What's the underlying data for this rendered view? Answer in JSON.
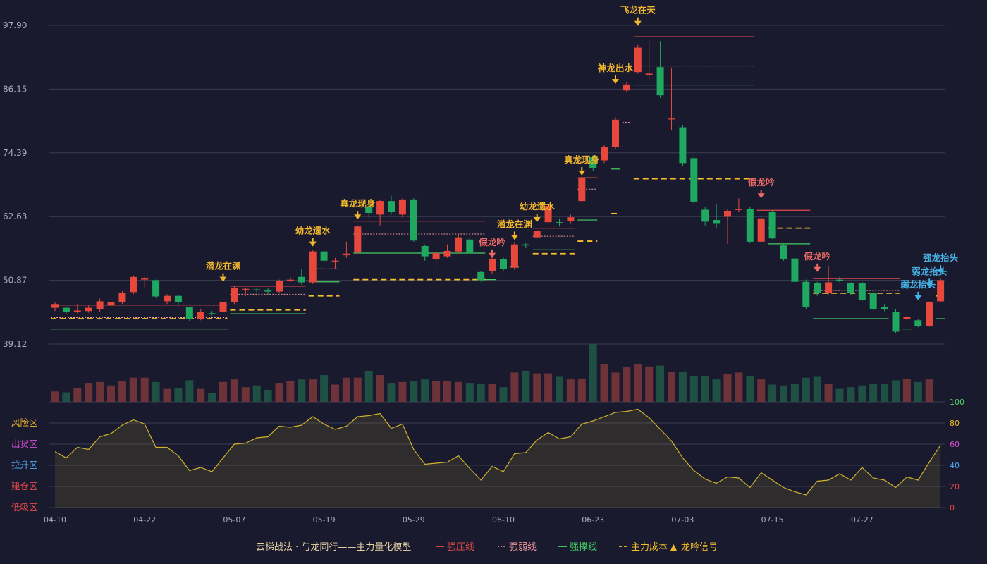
{
  "chart_data": {
    "type": "candlestick",
    "price_axis": {
      "ticks": [
        "97.90",
        "86.15",
        "74.39",
        "62.63",
        "50.87",
        "39.12"
      ],
      "range": [
        39.12,
        97.9
      ]
    },
    "date_ticks": [
      {
        "index": 0,
        "label": "04-10"
      },
      {
        "index": 8,
        "label": "04-22"
      },
      {
        "index": 16,
        "label": "05-07"
      },
      {
        "index": 24,
        "label": "05-19"
      },
      {
        "index": 32,
        "label": "05-29"
      },
      {
        "index": 40,
        "label": "06-10"
      },
      {
        "index": 48,
        "label": "06-23"
      },
      {
        "index": 56,
        "label": "07-03"
      },
      {
        "index": 64,
        "label": "07-15"
      },
      {
        "index": 72,
        "label": "07-27"
      }
    ],
    "candles": [
      [
        45.8,
        46.5,
        45.2,
        46.8
      ],
      [
        45.8,
        45.0,
        44.6,
        46.0
      ],
      [
        45.1,
        45.3,
        44.8,
        46.5
      ],
      [
        45.2,
        45.8,
        44.9,
        46.2
      ],
      [
        45.5,
        47.0,
        45.1,
        47.5
      ],
      [
        46.2,
        46.8,
        45.8,
        47.3
      ],
      [
        46.9,
        48.6,
        46.5,
        48.9
      ],
      [
        48.7,
        51.5,
        48.3,
        51.8
      ],
      [
        51.0,
        51.2,
        49.6,
        51.5
      ],
      [
        50.9,
        47.9,
        47.6,
        51.0
      ],
      [
        47.0,
        48.0,
        46.5,
        48.3
      ],
      [
        48.0,
        46.8,
        46.4,
        48.3
      ],
      [
        45.9,
        43.8,
        43.4,
        46.0
      ],
      [
        43.8,
        45.0,
        43.5,
        45.5
      ],
      [
        44.8,
        44.6,
        44.4,
        45.2
      ],
      [
        45.0,
        46.8,
        44.8,
        47.2
      ],
      [
        46.8,
        49.4,
        46.5,
        49.8
      ],
      [
        49.2,
        49.3,
        48.0,
        49.5
      ],
      [
        49.2,
        49.0,
        48.6,
        49.5
      ],
      [
        49.0,
        48.8,
        48.1,
        49.4
      ],
      [
        48.8,
        50.8,
        48.6,
        51.0
      ],
      [
        50.8,
        51.0,
        50.5,
        51.5
      ],
      [
        51.5,
        50.5,
        50.1,
        53.0
      ],
      [
        50.5,
        56.2,
        50.2,
        56.5
      ],
      [
        56.2,
        54.5,
        54.0,
        56.8
      ],
      [
        54.5,
        54.5,
        53.0,
        55.0
      ],
      [
        55.5,
        55.8,
        55.0,
        58.0
      ],
      [
        56.0,
        60.8,
        55.8,
        61.0
      ],
      [
        64.5,
        63.3,
        62.5,
        65.5
      ],
      [
        63.0,
        65.5,
        61.0,
        65.8
      ],
      [
        65.5,
        63.5,
        63.0,
        66.5
      ],
      [
        63.0,
        65.8,
        62.5,
        66.0
      ],
      [
        65.8,
        58.2,
        58.0,
        66.0
      ],
      [
        57.2,
        55.3,
        54.5,
        57.5
      ],
      [
        54.8,
        55.9,
        52.8,
        56.2
      ],
      [
        55.3,
        56.3,
        55.0,
        57.5
      ],
      [
        56.2,
        58.8,
        55.8,
        59.5
      ],
      [
        58.4,
        56.0,
        55.8,
        58.6
      ],
      [
        52.4,
        50.9,
        50.6,
        52.6
      ],
      [
        52.6,
        54.8,
        52.0,
        55.2
      ],
      [
        54.8,
        53.0,
        52.5,
        55.1
      ],
      [
        53.2,
        57.5,
        52.8,
        58.0
      ],
      [
        57.5,
        57.3,
        56.8,
        57.8
      ],
      [
        58.8,
        60.0,
        58.5,
        60.3
      ],
      [
        61.6,
        64.6,
        61.2,
        64.8
      ],
      [
        61.6,
        61.4,
        60.8,
        62.3
      ],
      [
        61.8,
        62.5,
        61.3,
        63.0
      ],
      [
        65.5,
        69.7,
        65.3,
        70.0
      ],
      [
        73.6,
        71.5,
        71.0,
        74.0
      ],
      [
        73.0,
        75.4,
        72.5,
        75.8
      ],
      [
        75.4,
        80.5,
        75.0,
        81.0
      ],
      [
        85.9,
        87.0,
        85.5,
        87.5
      ],
      [
        89.3,
        93.8,
        89.0,
        94.3
      ],
      [
        88.8,
        89.0,
        88.0,
        95.0
      ],
      [
        90.2,
        85.0,
        84.5,
        95.0
      ],
      [
        80.7,
        80.7,
        78.5,
        90.0
      ],
      [
        79.1,
        72.5,
        72.0,
        79.5
      ],
      [
        73.4,
        65.4,
        65.0,
        74.0
      ],
      [
        63.9,
        61.7,
        61.0,
        64.5
      ],
      [
        62.0,
        61.3,
        60.5,
        65.0
      ],
      [
        62.6,
        63.7,
        57.6,
        64.0
      ],
      [
        64.0,
        64.0,
        63.5,
        66.0
      ],
      [
        64.0,
        58.0,
        57.8,
        64.5
      ],
      [
        58.0,
        62.3,
        57.9,
        62.6
      ],
      [
        63.5,
        58.6,
        58.5,
        63.8
      ],
      [
        57.3,
        54.8,
        54.5,
        57.5
      ],
      [
        54.9,
        50.6,
        50.3,
        55.0
      ],
      [
        50.6,
        46.0,
        45.5,
        51.0
      ],
      [
        50.4,
        48.5,
        48.0,
        50.6
      ],
      [
        48.5,
        50.5,
        48.2,
        53.5
      ],
      [
        51.0,
        50.8,
        50.5,
        51.5
      ],
      [
        50.4,
        48.5,
        48.2,
        50.5
      ],
      [
        50.3,
        47.3,
        47.0,
        50.6
      ],
      [
        48.5,
        45.6,
        45.2,
        49.0
      ],
      [
        46.0,
        45.6,
        45.2,
        46.5
      ],
      [
        45.0,
        41.4,
        41.1,
        45.5
      ],
      [
        43.8,
        44.1,
        43.5,
        44.5
      ],
      [
        43.5,
        42.5,
        42.2,
        43.8
      ],
      [
        42.5,
        46.8,
        42.3,
        47.0
      ],
      [
        47.0,
        50.9,
        46.8,
        51.2
      ]
    ],
    "volumes": [
      12,
      11,
      16,
      22,
      23,
      19,
      24,
      28,
      28,
      23,
      15,
      16,
      25,
      15,
      10,
      23,
      26,
      17,
      19,
      14,
      22,
      24,
      26,
      26,
      31,
      20,
      28,
      28,
      36,
      31,
      22,
      23,
      24,
      26,
      24,
      24,
      23,
      22,
      21,
      21,
      17,
      34,
      36,
      33,
      33,
      29,
      26,
      27,
      67,
      44,
      34,
      40,
      44,
      41,
      42,
      35,
      35,
      30,
      30,
      26,
      32,
      34,
      30,
      26,
      20,
      19,
      21,
      28,
      29,
      21,
      15,
      17,
      19,
      21,
      21,
      25,
      27,
      23,
      26
    ],
    "volume_max": 67,
    "oscillator": {
      "ticks": [
        "100",
        "80",
        "60",
        "40",
        "20",
        "0"
      ],
      "zones": [
        "风险区",
        "出货区",
        "拉升区",
        "建仓区",
        "低吸区"
      ],
      "values": [
        53,
        47,
        57,
        55,
        67,
        70,
        78,
        83,
        79,
        57,
        57,
        49,
        35,
        38,
        34,
        47,
        60,
        61,
        66,
        67,
        77,
        76,
        78,
        86,
        79,
        74,
        77,
        86,
        87,
        89,
        75,
        79,
        55,
        41,
        42,
        43,
        49,
        37,
        26,
        39,
        34,
        51,
        52,
        64,
        71,
        65,
        67,
        79,
        82,
        86,
        90,
        91,
        93,
        85,
        74,
        63,
        47,
        35,
        27,
        23,
        29,
        28,
        19,
        33,
        26,
        19,
        15,
        12,
        25,
        26,
        32,
        26,
        38,
        28,
        26,
        19,
        29,
        26,
        43,
        59
      ]
    },
    "lines": {
      "strong_pressure": [
        {
          "from": 0,
          "to": 15,
          "value": 46.3
        },
        {
          "from": 16,
          "to": 22,
          "value": 49.8
        },
        {
          "from": 27,
          "to": 38,
          "value": 61.8
        },
        {
          "from": 43,
          "to": 46,
          "value": 60.5
        },
        {
          "from": 47,
          "to": 48,
          "value": 69.8
        },
        {
          "from": 52,
          "to": 62,
          "value": 95.8
        },
        {
          "from": 63,
          "to": 67,
          "value": 63.8
        },
        {
          "from": 68,
          "to": 75,
          "value": 51.2
        }
      ],
      "weak_pressure": [
        {
          "from": 0,
          "to": 15,
          "value": 44.0
        },
        {
          "from": 16,
          "to": 22,
          "value": 48.3
        },
        {
          "from": 23,
          "to": 25,
          "value": 53.0
        },
        {
          "from": 27,
          "to": 38,
          "value": 59.4
        },
        {
          "from": 43,
          "to": 46,
          "value": 59.0
        },
        {
          "from": 47,
          "to": 48,
          "value": 67.7
        },
        {
          "from": 51,
          "to": 51,
          "value": 80.0
        },
        {
          "from": 52,
          "to": 62,
          "value": 90.4
        },
        {
          "from": 64,
          "to": 67,
          "value": 60.5
        },
        {
          "from": 68,
          "to": 75,
          "value": 49.0
        }
      ],
      "support": [
        {
          "from": 0,
          "to": 15,
          "value": 41.9
        },
        {
          "from": 16,
          "to": 22,
          "value": 44.7
        },
        {
          "from": 23,
          "to": 25,
          "value": 50.6
        },
        {
          "from": 27,
          "to": 38,
          "value": 55.9
        },
        {
          "from": 38,
          "to": 39,
          "value": 51.0
        },
        {
          "from": 41,
          "to": 41,
          "value": 53.3
        },
        {
          "from": 43,
          "to": 46,
          "value": 56.5
        },
        {
          "from": 47,
          "to": 48,
          "value": 62.0
        },
        {
          "from": 50,
          "to": 50,
          "value": 71.4
        },
        {
          "from": 52,
          "to": 62,
          "value": 86.9
        },
        {
          "from": 64,
          "to": 67,
          "value": 57.6
        },
        {
          "from": 68,
          "to": 74,
          "value": 43.8
        },
        {
          "from": 76,
          "to": 76,
          "value": 41.9
        },
        {
          "from": 79,
          "to": 79,
          "value": 43.8
        }
      ],
      "main_cost": [
        {
          "from": 0,
          "to": 15,
          "value": 43.8
        },
        {
          "from": 16,
          "to": 22,
          "value": 45.4
        },
        {
          "from": 23,
          "to": 25,
          "value": 48.0
        },
        {
          "from": 27,
          "to": 38,
          "value": 51.0
        },
        {
          "from": 43,
          "to": 46,
          "value": 55.8
        },
        {
          "from": 47,
          "to": 48,
          "value": 58.1
        },
        {
          "from": 50,
          "to": 50,
          "value": 63.2
        },
        {
          "from": 52,
          "to": 62,
          "value": 69.6
        },
        {
          "from": 64,
          "to": 67,
          "value": 60.5
        },
        {
          "from": 68,
          "to": 75,
          "value": 48.5
        },
        {
          "from": 79,
          "to": 79,
          "value": 48.0
        }
      ]
    },
    "signals": [
      {
        "index": 15,
        "label": "潜龙在渊",
        "kind": "yellow",
        "dir": "down",
        "price": 51.0
      },
      {
        "index": 23,
        "label": "幼龙遗水",
        "kind": "yellow",
        "dir": "down",
        "price": 57.5
      },
      {
        "index": 27,
        "label": "真龙现身",
        "kind": "yellow",
        "dir": "down",
        "price": 62.5
      },
      {
        "index": 39,
        "label": "假龙吟",
        "kind": "red",
        "dir": "down",
        "price": 55.4
      },
      {
        "index": 41,
        "label": "潜龙在渊",
        "kind": "yellow",
        "dir": "down",
        "price": 58.7
      },
      {
        "index": 43,
        "label": "幼龙遗水",
        "kind": "yellow",
        "dir": "down",
        "price": 62.0
      },
      {
        "index": 47,
        "label": "真龙现身",
        "kind": "yellow",
        "dir": "down",
        "price": 70.6
      },
      {
        "index": 50,
        "label": "神龙出水",
        "kind": "yellow",
        "dir": "down",
        "price": 87.5
      },
      {
        "index": 52,
        "label": "飞龙在天",
        "kind": "yellow",
        "dir": "down",
        "price": 98.2
      },
      {
        "index": 63,
        "label": "假龙吟",
        "kind": "red",
        "dir": "down",
        "price": 66.4
      },
      {
        "index": 68,
        "label": "假龙吟",
        "kind": "red",
        "dir": "down",
        "price": 52.8
      },
      {
        "index": 77,
        "label": "弱龙抬头",
        "kind": "blue",
        "dir": "down",
        "price": 47.6
      },
      {
        "index": 78,
        "label": "弱龙抬头",
        "kind": "blue",
        "dir": "down",
        "price": 50.0
      },
      {
        "index": 79,
        "label": "强龙抬头",
        "kind": "blue",
        "dir": "down",
        "price": 52.5
      }
    ],
    "colors": {
      "up": "#e8483c",
      "down": "#1fa860",
      "vol_up": "#6e3339",
      "vol_down": "#1f5044",
      "pressure": "#e24a48",
      "weak": "#f49aa2",
      "support": "#41d064",
      "cost": "#f6c02d",
      "osc": "#d1b32d",
      "yellow_signal": "#f2b72b",
      "red_signal": "#ef6a67",
      "blue_signal": "#46b3e6"
    }
  },
  "legend": {
    "title": "云梯战法 · 与龙同行——主力量化模型",
    "items": [
      {
        "label": "强压线",
        "style": "solid",
        "color": "#e24a48"
      },
      {
        "label": "强弱线",
        "style": "dotted",
        "color": "#f49aa2"
      },
      {
        "label": "强撑线",
        "style": "solid",
        "color": "#41d064"
      },
      {
        "label": "主力成本",
        "style": "dashed",
        "color": "#f6c02d"
      },
      {
        "label": "龙吟信号",
        "style": "triangle",
        "color": "#f2b72b"
      }
    ]
  }
}
